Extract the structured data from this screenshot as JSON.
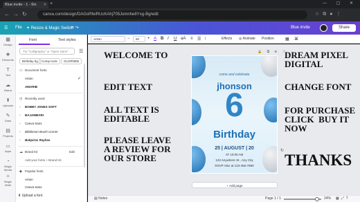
{
  "browser": {
    "tab_title": "Blue invite - 1 - 6in",
    "new_tab": "+",
    "url": "canva.com/design/DAGsRfeiRUcKAhj705Jomnhe8Yxg-Bg/edit",
    "window_controls": "— ▢ ✕"
  },
  "canva_header": {
    "file": "File",
    "resize": "✦ Resize & Magic Switch",
    "design_title": "Blue invite",
    "share": "Share"
  },
  "rail": [
    {
      "icon": "▦",
      "label": "Design"
    },
    {
      "icon": "❖",
      "label": "Elements"
    },
    {
      "icon": "T",
      "label": "Text"
    },
    {
      "icon": "☁",
      "label": "Brand"
    },
    {
      "icon": "⬆",
      "label": "Uploads"
    },
    {
      "icon": "✎",
      "label": "Draw"
    },
    {
      "icon": "▤",
      "label": "Projects"
    },
    {
      "icon": "⚏",
      "label": "Apps"
    },
    {
      "icon": "◔",
      "label": "Magic Media"
    },
    {
      "icon": "✧",
      "label": "Magic Write"
    }
  ],
  "font_panel": {
    "tab_font": "Font",
    "tab_styles": "Text styles",
    "search_placeholder": "Try \"Calligraphy\" or \"Open Sans\"",
    "chips": [
      "Birthday bg",
      "Comp tools",
      "GLORNEB"
    ],
    "document_fonts": "Document fonts",
    "doc_items": [
      "Anton",
      "AMARIB"
    ],
    "recently_used": "Recently used",
    "recent_items": [
      "BOBBY JONES SOFT",
      "BAJAMBARI",
      "Canva Sans",
      "Bibbleson Brush Corner",
      "Bukpirac Rayhas"
    ],
    "recent_arrows": [
      "›",
      "›",
      "›",
      "›",
      "›"
    ],
    "brand_kit": "Brand Kit",
    "brand_edit": "Edit",
    "brand_item": "Add your fonts + Brand Kit",
    "popular_fonts": "Popular fonts",
    "popular_items": [
      "Anton",
      "Canva Sans",
      "Open Sans"
    ],
    "upload_font": "Upload a font"
  },
  "toolbar": {
    "font": "Anton",
    "size": "60",
    "minus": "−",
    "plus": "+",
    "text_color": "A",
    "bold": "B",
    "italic": "I",
    "underline": "U",
    "case": "aA",
    "align": "≡",
    "list": "☰",
    "spacing": "↕",
    "effects": "Effects",
    "animate": "Animate",
    "position": "Position"
  },
  "canvas": {
    "left_texts": [
      "WELCOME TO",
      "EDIT TEXT",
      "ALL TEXT IS\nEDITABLE",
      "PLEASE LEAVE\nA REVIEW FOR\nOUR STORE"
    ],
    "right_texts": [
      "DREAM PIXEL\nDIGITAL",
      "CHANGE FONT",
      "FOR PURCHASE\nCLICK  BUY IT\nNOW",
      "THANKS"
    ],
    "page_icons": "🔒 ⧉ ⊕ ↗",
    "invite": {
      "come": "come and celebrate",
      "name": "jhonson",
      "number": "6",
      "birthday": "Birthday",
      "date": "25 | AUGUST | 20",
      "time": "AT 10:00 AM",
      "address": "123 Anywhere St., Any City",
      "rsvp": "RSVP Alex at 123-456-7890"
    },
    "add_page": "+ Add page",
    "refresh": "↻"
  },
  "footer": {
    "notes": "Notes",
    "page": "Page 1 / 1",
    "zoom": "24%"
  },
  "colors": {
    "accent": "#7d2ae8",
    "balloon": "#2f86c7"
  }
}
